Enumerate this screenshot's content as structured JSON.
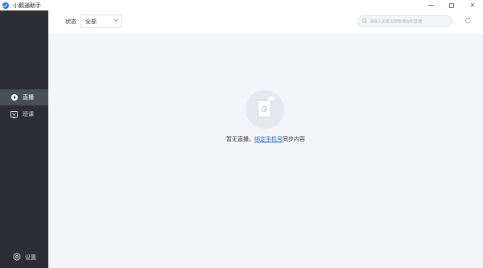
{
  "window": {
    "title": "小鹅通助手",
    "controls": [
      "minimize",
      "maximize",
      "close"
    ]
  },
  "sidebar": {
    "items": [
      {
        "label": "直播",
        "icon": "play-circle-icon",
        "active": true
      },
      {
        "label": "班课",
        "icon": "class-icon",
        "active": false
      }
    ],
    "settings_label": "设置"
  },
  "toolbar": {
    "status_label": "状态",
    "status_value": "全部",
    "search_placeholder": "请输入关键词搜索课程和直播"
  },
  "empty_state": {
    "text_prefix": "暂无直播，",
    "link_text": "绑定手机号",
    "text_suffix": "同步内容"
  },
  "colors": {
    "sidebar_bg": "#2b2d33",
    "sidebar_active": "#4a4e59",
    "content_bg": "#f4f5f9",
    "link": "#1e6fd9",
    "logo": "#1a73e8"
  }
}
